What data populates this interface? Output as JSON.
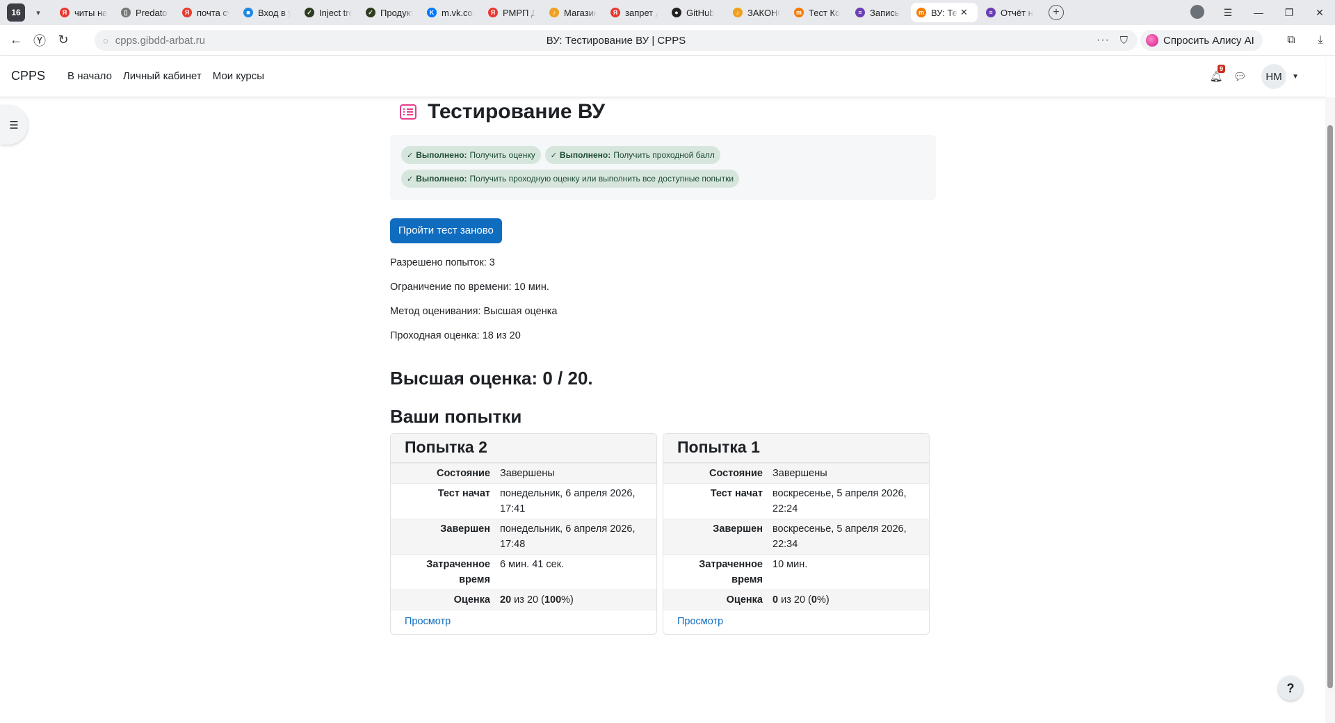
{
  "browser": {
    "tab_count": "16",
    "tabs": [
      {
        "label": "читы на",
        "fav_color": "#e8382f",
        "fav_glyph": "Я"
      },
      {
        "label": "Predator",
        "fav_color": "#777777",
        "fav_glyph": "▯"
      },
      {
        "label": "почта су",
        "fav_color": "#e8382f",
        "fav_glyph": "Я"
      },
      {
        "label": "Вход в у",
        "fav_color": "#1e88e5",
        "fav_glyph": "■"
      },
      {
        "label": "Inject tro",
        "fav_color": "#2e3b1e",
        "fav_glyph": "✓"
      },
      {
        "label": "Продукт",
        "fav_color": "#2e3b1e",
        "fav_glyph": "✓"
      },
      {
        "label": "m.vk.com",
        "fav_color": "#0077ff",
        "fav_glyph": "K"
      },
      {
        "label": "РМРП Д",
        "fav_color": "#e8382f",
        "fav_glyph": "Я"
      },
      {
        "label": "Магазин",
        "fav_color": "#f0a020",
        "fav_glyph": "♪"
      },
      {
        "label": "запрет д",
        "fav_color": "#e8382f",
        "fav_glyph": "Я"
      },
      {
        "label": "GitHub",
        "fav_color": "#222222",
        "fav_glyph": "●"
      },
      {
        "label": "ЗАКОНС",
        "fav_color": "#f0a020",
        "fav_glyph": "♪"
      },
      {
        "label": "Тест Ко",
        "fav_color": "#f57c00",
        "fav_glyph": "m"
      },
      {
        "label": "Запись",
        "fav_color": "#6a3fb5",
        "fav_glyph": "≡"
      }
    ],
    "active_tab": {
      "label": "ВУ: Те",
      "fav_color": "#f57c00",
      "fav_glyph": "m",
      "close": "✕"
    },
    "trailing_tab": {
      "label": "Отчёт на",
      "fav_color": "#6a3fb5",
      "fav_glyph": "≡"
    },
    "new_tab": "+",
    "url": "cpps.gibdd-arbat.ru",
    "page_title": "ВУ: Тестирование ВУ | CPPS",
    "alice_label": "Спросить Алису AI"
  },
  "site": {
    "brand": "CPPS",
    "nav": [
      "В начало",
      "Личный кабинет",
      "Мои курсы"
    ],
    "notification_count": "9",
    "user_initials": "НМ"
  },
  "quiz": {
    "title": "Тестирование ВУ",
    "completion": [
      {
        "status": "Выполнено:",
        "text": "Получить оценку"
      },
      {
        "status": "Выполнено:",
        "text": "Получить проходной балл"
      },
      {
        "status": "Выполнено:",
        "text": "Получить проходную оценку или выполнить все доступные попытки"
      }
    ],
    "retake_button": "Пройти тест заново",
    "info": [
      "Разрешено попыток: 3",
      "Ограничение по времени: 10 мин.",
      "Метод оценивания: Высшая оценка",
      "Проходная оценка: 18 из 20"
    ],
    "best_grade": "Высшая оценка: 0 / 20.",
    "attempts_heading": "Ваши попытки",
    "attempts": [
      {
        "title": "Попытка 2",
        "rows": [
          {
            "label": "Состояние",
            "value": "Завершены"
          },
          {
            "label": "Тест начат",
            "value": "понедельник, 6 апреля 2026, 17:41"
          },
          {
            "label": "Завершен",
            "value": "понедельник, 6 апреля 2026, 17:48"
          },
          {
            "label": "Затраченное время",
            "value": "6 мин. 41 сек."
          }
        ],
        "grade_label": "Оценка",
        "grade_score": "20",
        "grade_mid": " из 20 (",
        "grade_pct": "100",
        "grade_end": "%)",
        "review": "Просмотр"
      },
      {
        "title": "Попытка 1",
        "rows": [
          {
            "label": "Состояние",
            "value": "Завершены"
          },
          {
            "label": "Тест начат",
            "value": "воскресенье, 5 апреля 2026, 22:24"
          },
          {
            "label": "Завершен",
            "value": "воскресенье, 5 апреля 2026, 22:34"
          },
          {
            "label": "Затраченное время",
            "value": "10 мин."
          }
        ],
        "grade_label": "Оценка",
        "grade_score": "0",
        "grade_mid": " из 20 (",
        "grade_pct": "0",
        "grade_end": "%)",
        "review": "Просмотр"
      }
    ]
  },
  "help": "?",
  "colors": {
    "accent": "#0f6cbf",
    "quiz_icon": "#e83e8c",
    "completion_badge": "#d7e6dd",
    "notification": "#ca3120"
  }
}
